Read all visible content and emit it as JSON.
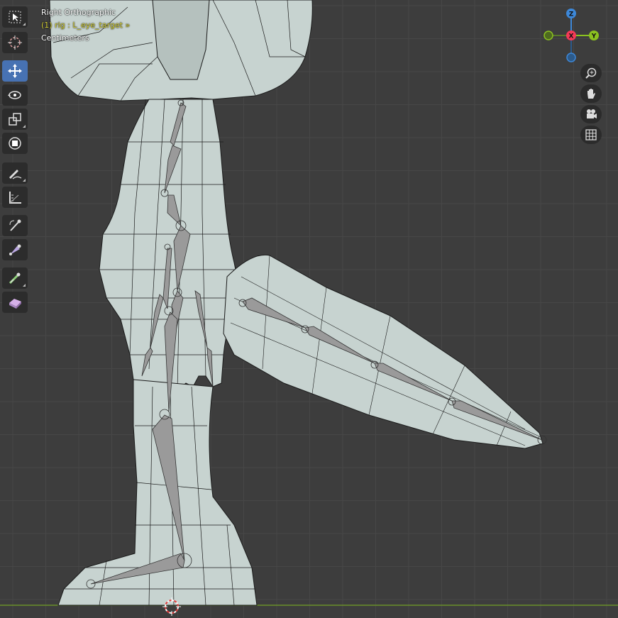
{
  "viewport": {
    "view_name": "Right Orthographic",
    "active_object": "(1) rig : L_eye_target »",
    "units": "Centimeters"
  },
  "toolbar": {
    "tools": [
      {
        "name": "select-box",
        "icon": "select-box-icon",
        "active": false
      },
      {
        "name": "cursor",
        "icon": "cursor-icon",
        "active": false
      },
      {
        "name": "move",
        "icon": "move-icon",
        "active": true
      },
      {
        "name": "rotate",
        "icon": "rotate-icon",
        "active": false
      },
      {
        "name": "scale",
        "icon": "scale-icon",
        "active": false
      },
      {
        "name": "transform",
        "icon": "transform-icon",
        "active": false
      },
      {
        "name": "annotate",
        "icon": "annotate-icon",
        "active": false
      },
      {
        "name": "measure",
        "icon": "measure-icon",
        "active": false
      },
      {
        "name": "bone-roll",
        "icon": "bone-roll-icon",
        "active": false
      },
      {
        "name": "bone-size",
        "icon": "bone-size-icon",
        "active": false
      },
      {
        "name": "bone-extrude",
        "icon": "bone-extrude-icon",
        "active": false
      },
      {
        "name": "bone-envelope",
        "icon": "bone-envelope-icon",
        "active": false
      }
    ]
  },
  "gizmo": {
    "z_label": "Z",
    "x_label": "X",
    "y_label": "Y",
    "colors": {
      "x": "#f53a57",
      "y": "#8bc220",
      "z": "#3d88d9"
    }
  },
  "navigation": [
    {
      "icon": "zoom-icon"
    },
    {
      "icon": "pan-hand-icon"
    },
    {
      "icon": "camera-icon"
    },
    {
      "icon": "ortho-grid-icon"
    }
  ],
  "colors": {
    "background": "#3d3d3d",
    "grid": "#474747",
    "mesh_fill": "#c7d3d0",
    "mesh_wire": "#1a1a1a",
    "bone": "#9a9a9a",
    "active_tool": "#4772b3",
    "active_object_text": "#d9d43a",
    "ground_line": "#6a8f2a"
  }
}
